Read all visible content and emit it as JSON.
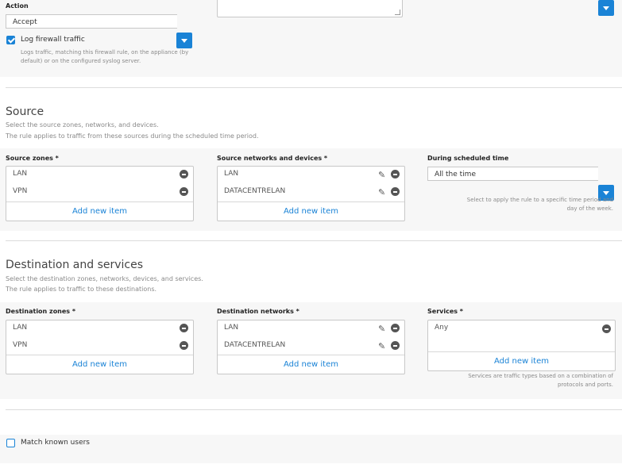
{
  "action": {
    "label": "Action",
    "value": "Accept"
  },
  "log": {
    "label": "Log firewall traffic",
    "checked": true,
    "desc_line1": "Logs traffic, matching this firewall rule, on the appliance (by",
    "desc_line2": "default) or on the configured syslog server."
  },
  "source": {
    "title": "Source",
    "desc_line1": "Select the source zones, networks, and devices.",
    "desc_line2": "The rule applies to traffic from these sources during the scheduled time period.",
    "zones_label": "Source zones *",
    "zones": [
      "LAN",
      "VPN"
    ],
    "networks_label": "Source networks and devices *",
    "networks": [
      "LAN",
      "DATACENTRELAN"
    ],
    "add_label": "Add new item",
    "schedule_label": "During scheduled time",
    "schedule_value": "All the time",
    "schedule_hint_line1": "Select to apply the rule to a specific time period and",
    "schedule_hint_line2": "day of the week."
  },
  "destination": {
    "title": "Destination and services",
    "desc_line1": "Select the destination zones, networks, devices, and services.",
    "desc_line2": "The rule applies to traffic to these destinations.",
    "zones_label": "Destination zones *",
    "zones": [
      "LAN",
      "VPN"
    ],
    "networks_label": "Destination networks *",
    "networks": [
      "LAN",
      "DATACENTRELAN"
    ],
    "services_label": "Services *",
    "services": [
      "Any"
    ],
    "add_label": "Add new item",
    "services_hint_line1": "Services are traffic types based on a combination of",
    "services_hint_line2": "protocols and ports."
  },
  "users": {
    "label": "Match known users",
    "checked": false
  },
  "colors": {
    "accent": "#1a83d6",
    "band": "#f7f7f7"
  }
}
